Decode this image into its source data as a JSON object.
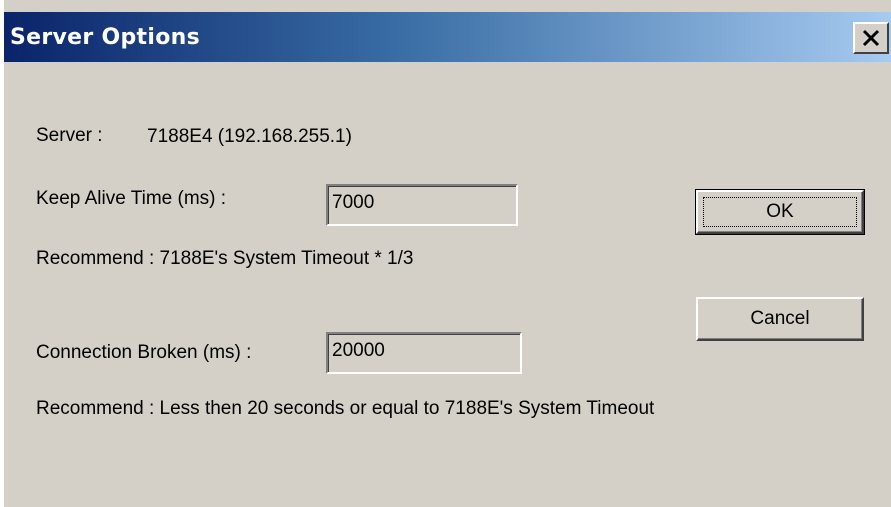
{
  "window": {
    "title": "Server Options",
    "close_glyph": "✕"
  },
  "server": {
    "label": "Server :",
    "value": "7188E4 (192.168.255.1)"
  },
  "keep_alive": {
    "label": "Keep Alive Time (ms) :",
    "value": "7000",
    "recommend": "Recommend : 7188E's System Timeout * 1/3"
  },
  "connection_broken": {
    "label": "Connection Broken (ms) :",
    "value": "20000",
    "recommend": "Recommend : Less then 20 seconds or equal to 7188E's System Timeout"
  },
  "buttons": {
    "ok_label": "OK",
    "cancel_label": "Cancel"
  },
  "icons": {
    "close": "close-icon"
  },
  "colors": {
    "titlebar_start": "#0a246a",
    "titlebar_end": "#a6caf0",
    "face": "#d4d0c8"
  }
}
